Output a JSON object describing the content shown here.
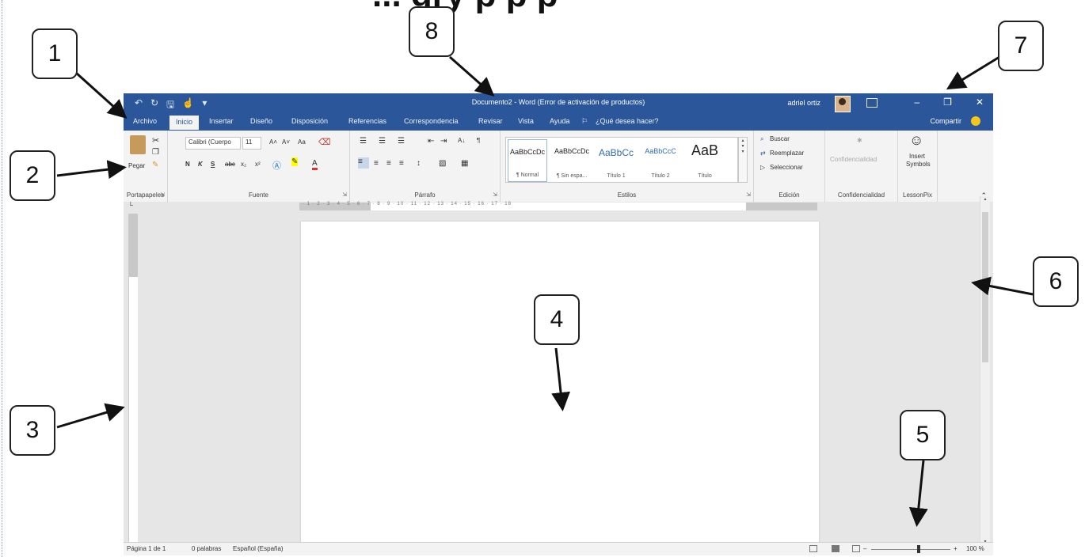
{
  "heading_fragment": "... gry   p     p      p",
  "callouts": [
    "1",
    "2",
    "3",
    "4",
    "5",
    "6",
    "7",
    "8"
  ],
  "window": {
    "title": "Documento2  -  Word (Error de activación de productos)",
    "user_name": "adriel ortiz",
    "quick_access": {
      "undo_icon": "undo-icon",
      "redo_icon": "redo-icon",
      "save_icon": "save-icon",
      "touch_icon": "touch-mode-icon",
      "customize_icon": "customize-qat-icon"
    },
    "controls": {
      "minimize": "–",
      "restore": "❐",
      "close": "✕"
    }
  },
  "tabs": [
    "Archivo",
    "Inicio",
    "Insertar",
    "Diseño",
    "Disposición",
    "Referencias",
    "Correspondencia",
    "Revisar",
    "Vista",
    "Ayuda"
  ],
  "tell_me": "¿Qué desea hacer?",
  "share": "Compartir",
  "ribbon": {
    "clipboard": {
      "paste": "Pegar",
      "label": "Portapapeles"
    },
    "font": {
      "font_name": "Calibri (Cuerpo",
      "font_size": "11",
      "grow": "A˄",
      "shrink": "A˅",
      "case": "Aa",
      "bold": "N",
      "italic": "K",
      "underline": "S",
      "strike": "abc",
      "subscript": "x₂",
      "superscript": "x²",
      "label": "Fuente"
    },
    "paragraph": {
      "label": "Párrafo",
      "sort": "A↓",
      "pilcrow": "¶"
    },
    "styles": {
      "label": "Estilos",
      "items": [
        {
          "sample": "AaBbCcDc",
          "name": "¶ Normal"
        },
        {
          "sample": "AaBbCcDc",
          "name": "¶ Sin espa..."
        },
        {
          "sample": "AaBbCc",
          "name": "Título 1"
        },
        {
          "sample": "AaBbCcC",
          "name": "Título 2"
        },
        {
          "sample": "AaB",
          "name": "Título"
        }
      ]
    },
    "editing": {
      "label": "Edición",
      "find": "Buscar",
      "replace": "Reemplazar",
      "select": "Seleccionar"
    },
    "sensitivity": {
      "button": "Confidencialidad",
      "label": "Confidencialidad"
    },
    "lessonpix": {
      "button_line1": "Insert",
      "button_line2": "Symbols",
      "label": "LessonPix"
    }
  },
  "ruler_ticks": "· 1 · 2 · 3 · 4 · 5 · 6 · 7 · 8 · 9 · 10 · 11 · 12 · 13 · 14 · 15 · 16 · 17 · 18",
  "status": {
    "page": "Página 1 de 1",
    "words": "0 palabras",
    "language": "Español (España)",
    "zoom_minus": "–",
    "zoom_plus": "+",
    "zoom": "100 %"
  }
}
